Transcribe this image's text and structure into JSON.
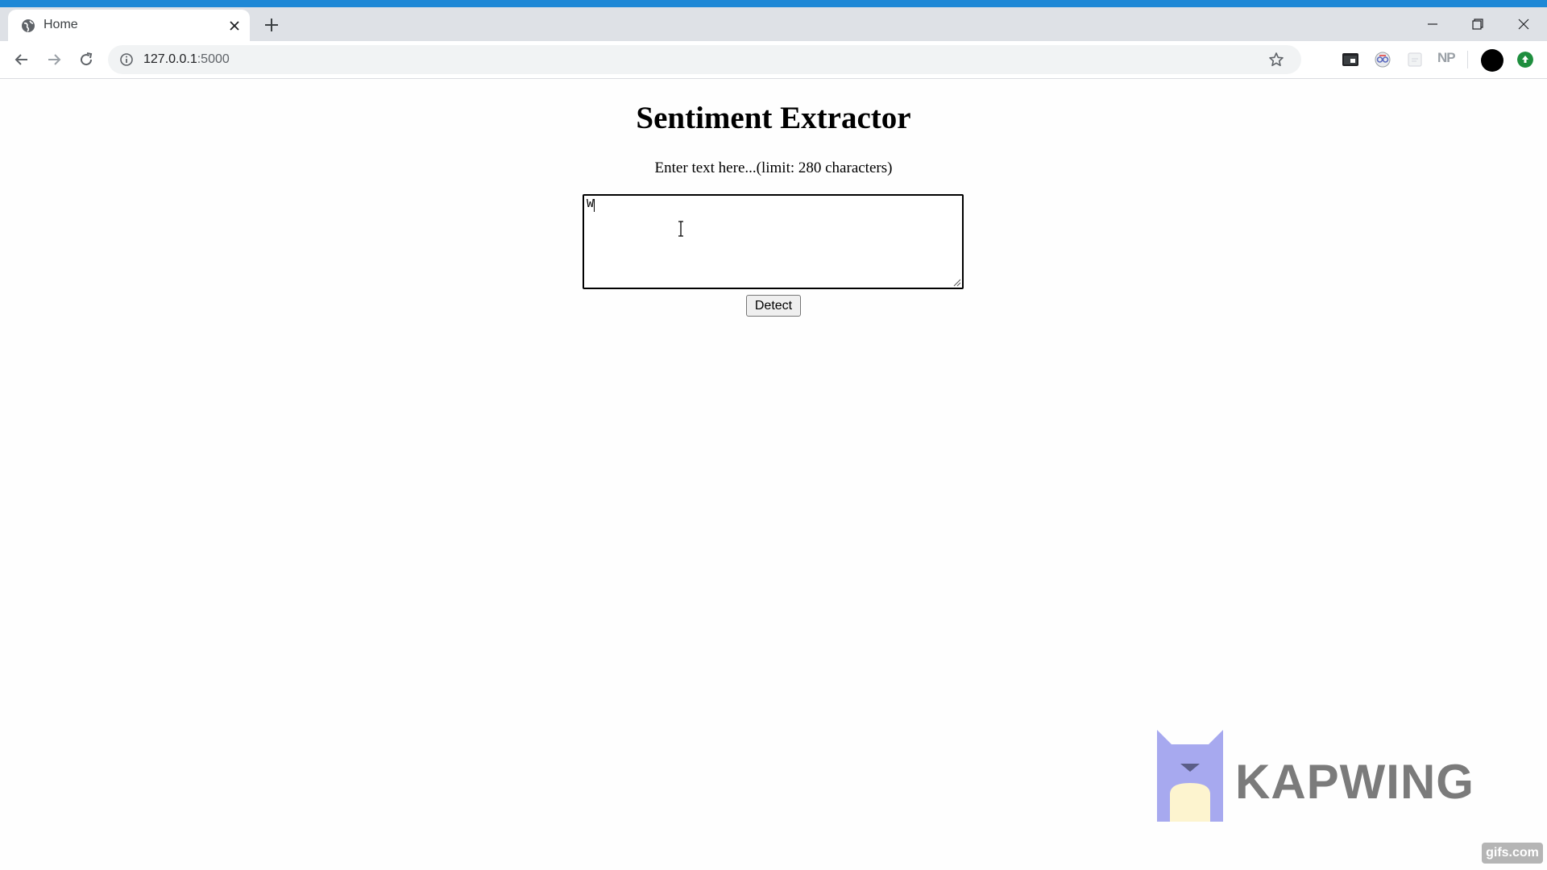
{
  "browser": {
    "tab": {
      "title": "Home",
      "favicon": "globe-icon"
    },
    "address_bar": {
      "host": "127.0.0.1",
      "port": ":5000"
    },
    "extensions": {
      "np_label": "NP"
    },
    "colors": {
      "title_strip": "#1e88d6",
      "tab_strip": "#dee1e6",
      "update_icon": "#1e8e3e"
    }
  },
  "page": {
    "title": "Sentiment Extractor",
    "label": "Enter text here...(limit: 280 characters)",
    "textarea_value": "W",
    "detect_button": "Detect"
  },
  "watermarks": {
    "kapwing": "KAPWING",
    "gifs": "gifs.com"
  }
}
